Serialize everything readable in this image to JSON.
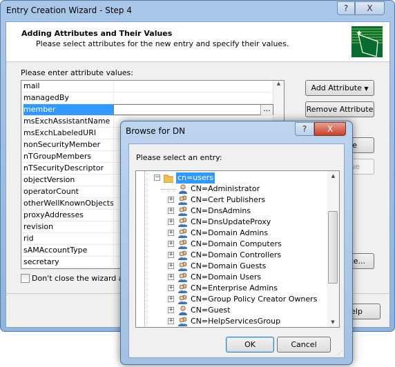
{
  "wizard": {
    "title": "Entry Creation Wizard - Step 4",
    "help_glyph": "?",
    "close_glyph": "X",
    "header_title": "Adding Attributes and Their Values",
    "header_subtitle": "Please select attributes for the new entry and specify their values.",
    "list_label": "Please enter attribute values:",
    "attributes": [
      "mail",
      "managedBy",
      "member",
      "msExchAssistantName",
      "msExchLabeledURI",
      "nonSecurityMember",
      "nTGroupMembers",
      "nTSecurityDescriptor",
      "objectVersion",
      "operatorCount",
      "otherWellKnownObjects",
      "proxyAddresses",
      "revision",
      "rid",
      "sAMAccountType",
      "secretary"
    ],
    "selected_attribute": "member",
    "ellipsis": "...",
    "add_attribute": "Add Attribute",
    "remove_attribute": "Remove Attribute",
    "hidden_btn1": "e",
    "hidden_btn2": "lue",
    "hidden_btn3": "te...",
    "help_partial": "elp",
    "dont_close": "Don't close the wizard afte",
    "dont_close_checked": false
  },
  "browse": {
    "title": "Browse for DN",
    "help_glyph": "?",
    "close_glyph": "X",
    "prompt": "Please select an entry:",
    "root": "cn=users",
    "entries": [
      {
        "label": "CN=Administrator",
        "icon": "user",
        "expandable": false
      },
      {
        "label": "CN=Cert Publishers",
        "icon": "group",
        "expandable": true
      },
      {
        "label": "CN=DnsAdmins",
        "icon": "group",
        "expandable": true
      },
      {
        "label": "CN=DnsUpdateProxy",
        "icon": "group",
        "expandable": true
      },
      {
        "label": "CN=Domain Admins",
        "icon": "group",
        "expandable": true
      },
      {
        "label": "CN=Domain Computers",
        "icon": "group",
        "expandable": true
      },
      {
        "label": "CN=Domain Controllers",
        "icon": "group",
        "expandable": true
      },
      {
        "label": "CN=Domain Guests",
        "icon": "group",
        "expandable": true
      },
      {
        "label": "CN=Domain Users",
        "icon": "group",
        "expandable": true
      },
      {
        "label": "CN=Enterprise Admins",
        "icon": "group",
        "expandable": true
      },
      {
        "label": "CN=Group Policy Creator Owners",
        "icon": "group",
        "expandable": true
      },
      {
        "label": "CN=Guest",
        "icon": "user",
        "expandable": true
      },
      {
        "label": "CN=HelpServicesGroup",
        "icon": "group",
        "expandable": true
      }
    ],
    "ok": "OK",
    "cancel": "Cancel"
  },
  "colors": {
    "selection": "#3399ff",
    "logo": "#0a6b2e"
  }
}
